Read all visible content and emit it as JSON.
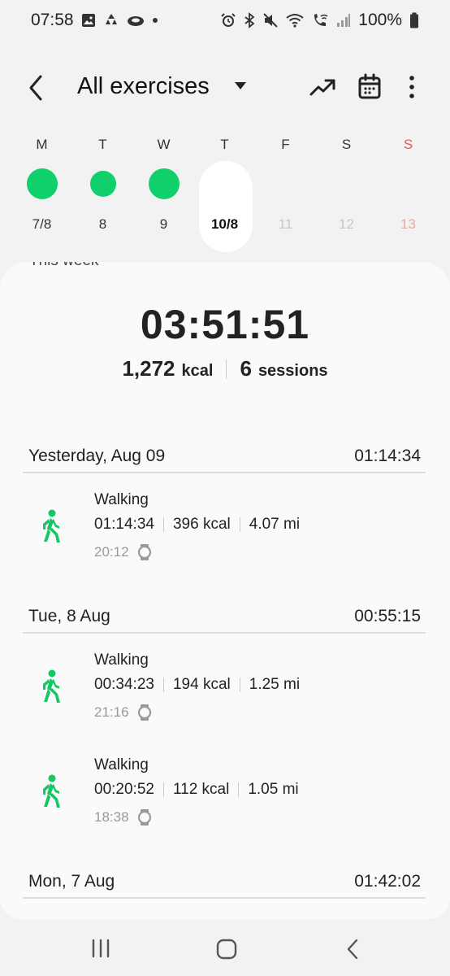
{
  "status_bar": {
    "time": "07:58",
    "battery": "100%",
    "left_icons": [
      "gallery-icon",
      "recycle-icon",
      "cloud-icon",
      "dot-icon"
    ],
    "right_icons": [
      "alarm-icon",
      "bluetooth-icon",
      "mute-icon",
      "wifi-icon",
      "wifi-call-icon",
      "signal-icon",
      "battery-icon"
    ]
  },
  "header": {
    "title": "All exercises"
  },
  "week": {
    "days": [
      {
        "letter": "M",
        "date": "7/8",
        "has_exercise": true
      },
      {
        "letter": "T",
        "date": "8",
        "has_exercise": true
      },
      {
        "letter": "W",
        "date": "9",
        "has_exercise": true
      },
      {
        "letter": "T",
        "date": "10/8",
        "has_exercise": false,
        "today": true
      },
      {
        "letter": "F",
        "date": "11",
        "has_exercise": false
      },
      {
        "letter": "S",
        "date": "12",
        "has_exercise": false
      },
      {
        "letter": "S",
        "date": "13",
        "has_exercise": false
      }
    ]
  },
  "summary": {
    "peek_label": "This week",
    "total_time": "03:51:51",
    "kcal_value": "1,272",
    "kcal_unit": "kcal",
    "sessions_value": "6",
    "sessions_unit": "sessions"
  },
  "groups": [
    {
      "date": "Yesterday, Aug 09",
      "total": "01:14:34",
      "sessions": [
        {
          "type": "Walking",
          "duration": "01:14:34",
          "kcal": "396 kcal",
          "distance": "4.07 mi",
          "time": "20:12"
        }
      ]
    },
    {
      "date": "Tue, 8 Aug",
      "total": "00:55:15",
      "sessions": [
        {
          "type": "Walking",
          "duration": "00:34:23",
          "kcal": "194 kcal",
          "distance": "1.25 mi",
          "time": "21:16"
        },
        {
          "type": "Walking",
          "duration": "00:20:52",
          "kcal": "112 kcal",
          "distance": "1.05 mi",
          "time": "18:38"
        }
      ]
    },
    {
      "date": "Mon, 7 Aug",
      "total": "01:42:02",
      "sessions": []
    }
  ],
  "colors": {
    "accent_green": "#0fd06a",
    "sunday_red": "#d6605a"
  }
}
